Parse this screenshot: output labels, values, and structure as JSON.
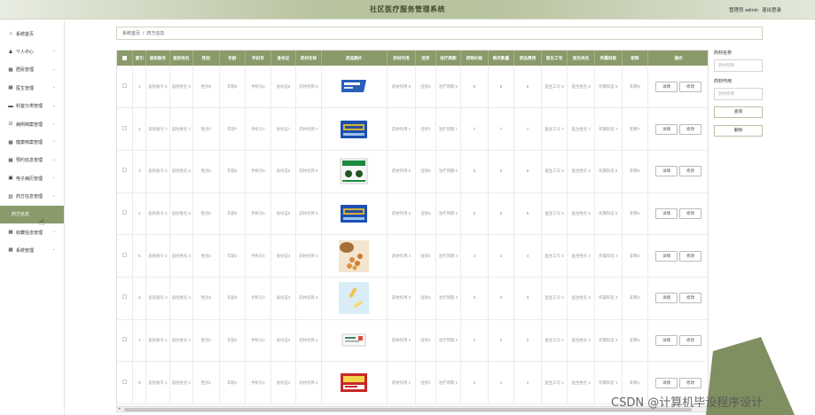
{
  "app": {
    "title": "社区医疗服务管理系统",
    "user_label": "管理员 admin",
    "logout_label": "退出登录"
  },
  "sidebar": {
    "items": [
      {
        "label": "系统首页",
        "icon": "home-icon",
        "glyph": "⌂",
        "chevron": false
      },
      {
        "label": "个人中心",
        "icon": "user-icon",
        "glyph": "♟",
        "chevron": true
      },
      {
        "label": "居民管理",
        "icon": "grid-icon",
        "glyph": "▦",
        "chevron": true
      },
      {
        "label": "医生管理",
        "icon": "grid-icon",
        "glyph": "▦",
        "chevron": true
      },
      {
        "label": "科室分类管理",
        "icon": "monitor-icon",
        "glyph": "▬",
        "chevron": true
      },
      {
        "label": "病例档案管理",
        "icon": "edit-icon",
        "glyph": "☑",
        "chevron": true
      },
      {
        "label": "健康档案管理",
        "icon": "grid-icon",
        "glyph": "▦",
        "chevron": true
      },
      {
        "label": "预约信息管理",
        "icon": "grid-icon",
        "glyph": "▦",
        "chevron": true
      },
      {
        "label": "电子病历管理",
        "icon": "doc-icon",
        "glyph": "▣",
        "chevron": true
      },
      {
        "label": "药方信息管理",
        "icon": "chart-icon",
        "glyph": "▥",
        "chevron": true
      }
    ],
    "active_sub": "药方信息",
    "items_after": [
      {
        "label": "收藏信息管理",
        "icon": "grid-icon",
        "glyph": "▦",
        "chevron": true
      },
      {
        "label": "系统管理",
        "icon": "grid-icon",
        "glyph": "▦",
        "chevron": true
      }
    ]
  },
  "breadcrumb": {
    "home": "系统首页",
    "separator": "/",
    "current": "药方信息"
  },
  "table": {
    "headers": [
      "",
      "索引",
      "居民账号",
      "居民姓名",
      "性别",
      "年龄",
      "手机号",
      "身份证",
      "药材名称",
      "药品图片",
      "药材作用",
      "症状",
      "治疗周期",
      "药物价格",
      "购买数量",
      "药品费用",
      "医生工号",
      "医生姓名",
      "所属科室",
      "职称",
      "操作"
    ],
    "detail_label": "详情",
    "edit_label": "修改",
    "rows": [
      {
        "idx": "1",
        "account": "居民账号 8",
        "name": "居民姓名 8",
        "gender": "性别8",
        "age": "年龄8",
        "phone": "手机号8",
        "idcard": "身份证8",
        "herb": "药材名称 8",
        "img": "blue-box",
        "effect": "药材作用 8",
        "symptom": "症状8",
        "period": "治疗周期 8",
        "price": "8",
        "qty": "8",
        "fee": "8",
        "docno": "医生工号 8",
        "docname": "医生姓名 8",
        "dept": "所属科室 8",
        "title": "职称8"
      },
      {
        "idx": "2",
        "account": "居民账号 7",
        "name": "居民姓名 7",
        "gender": "性别7",
        "age": "年龄7",
        "phone": "手机号7",
        "idcard": "身份证7",
        "herb": "药材名称 7",
        "img": "blue-gold",
        "effect": "药材作用 7",
        "symptom": "症状7",
        "period": "治疗周期 7",
        "price": "7",
        "qty": "7",
        "fee": "7",
        "docno": "医生工号 7",
        "docname": "医生姓名 7",
        "dept": "所属科室 7",
        "title": "职称7"
      },
      {
        "idx": "3",
        "account": "居民账号 6",
        "name": "居民姓名 6",
        "gender": "性别6",
        "age": "年龄6",
        "phone": "手机号6",
        "idcard": "身份证6",
        "herb": "药材名称 6",
        "img": "green-box",
        "effect": "药材作用 6",
        "symptom": "症状6",
        "period": "治疗周期 6",
        "price": "6",
        "qty": "6",
        "fee": "6",
        "docno": "医生工号 6",
        "docname": "医生姓名 6",
        "dept": "所属科室 6",
        "title": "职称6"
      },
      {
        "idx": "4",
        "account": "居民账号 5",
        "name": "居民姓名 5",
        "gender": "性别5",
        "age": "年龄5",
        "phone": "手机号5",
        "idcard": "身份证5",
        "herb": "药材名称 5",
        "img": "blue-gold",
        "effect": "药材作用 5",
        "symptom": "症状5",
        "period": "治疗周期 5",
        "price": "5",
        "qty": "5",
        "fee": "5",
        "docno": "医生工号 5",
        "docname": "医生姓名 5",
        "dept": "所属科室 5",
        "title": "职称5"
      },
      {
        "idx": "5",
        "account": "居民账号 4",
        "name": "居民姓名 4",
        "gender": "性别4",
        "age": "年龄4",
        "phone": "手机号4",
        "idcard": "身份证4",
        "herb": "药材名称 4",
        "img": "pills",
        "effect": "药材作用 4",
        "symptom": "症状4",
        "period": "治疗周期 4",
        "price": "4",
        "qty": "4",
        "fee": "4",
        "docno": "医生工号 4",
        "docname": "医生姓名 4",
        "dept": "所属科室 4",
        "title": "职称4"
      },
      {
        "idx": "6",
        "account": "居民账号 3",
        "name": "居民姓名 3",
        "gender": "性别3",
        "age": "年龄3",
        "phone": "手机号3",
        "idcard": "身份证3",
        "herb": "药材名称 3",
        "img": "capsules",
        "effect": "药材作用 3",
        "symptom": "症状3",
        "period": "治疗周期 3",
        "price": "3",
        "qty": "3",
        "fee": "3",
        "docno": "医生工号 3",
        "docname": "医生姓名 3",
        "dept": "所属科室 3",
        "title": "职称3"
      },
      {
        "idx": "7",
        "account": "居民账号 2",
        "name": "居民姓名 2",
        "gender": "性别2",
        "age": "年龄2",
        "phone": "手机号2",
        "idcard": "身份证2",
        "herb": "药材名称 2",
        "img": "white-box",
        "effect": "药材作用 2",
        "symptom": "症状2",
        "period": "治疗周期 2",
        "price": "2",
        "qty": "2",
        "fee": "2",
        "docno": "医生工号 2",
        "docname": "医生姓名 2",
        "dept": "所属科室 2",
        "title": "职称2"
      },
      {
        "idx": "8",
        "account": "居民账号 1",
        "name": "居民姓名 1",
        "gender": "性别1",
        "age": "年龄1",
        "phone": "手机号1",
        "idcard": "身份证1",
        "herb": "药材名称 1",
        "img": "red-box",
        "effect": "药材作用 1",
        "symptom": "症状1",
        "period": "治疗周期 1",
        "price": "1",
        "qty": "1",
        "fee": "1",
        "docno": "医生工号 1",
        "docname": "医生姓名 1",
        "dept": "所属科室 1",
        "title": "职称1"
      }
    ]
  },
  "search": {
    "herb_label": "药材名称",
    "herb_placeholder": "药材名称",
    "effect_label": "药材作用",
    "effect_placeholder": "药材作用",
    "query_button": "查询",
    "delete_button": "删除"
  },
  "watermark": "CSDN @计算机毕设程序设计",
  "colors": {
    "accent": "#8a9a6a",
    "header_bar": "#b7c29f",
    "deco": "#7f8f60"
  }
}
